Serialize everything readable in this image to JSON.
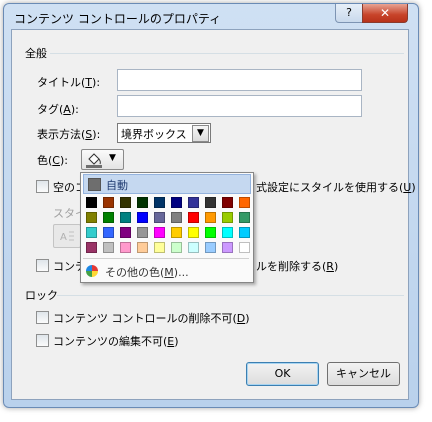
{
  "window": {
    "title": "コンテンツ コントロールのプロパティ",
    "help_label": "?",
    "close_label": "✕"
  },
  "general": {
    "section_label": "全般",
    "title_label": "タイトル(",
    "title_key": "T",
    "tag_label": "タグ(",
    "tag_key": "A",
    "show_as_label": "表示方法(",
    "show_as_key": "S",
    "show_as_value": "境界ボックス",
    "color_label": "色(",
    "color_key": "C",
    "style_check_label_pre": "空のコ",
    "style_check_label_post": "式設定にスタイルを使用する(",
    "style_check_key": "U",
    "style_label": "スタイ",
    "remove_check_label_pre": "コンテ",
    "remove_check_label_post": "ルを削除する(",
    "remove_check_key": "R",
    "close_paren": ")"
  },
  "lock": {
    "section_label": "ロック",
    "no_delete_label": "コンテンツ コントロールの削除不可(",
    "no_delete_key": "D",
    "no_edit_label": "コンテンツの編集不可(",
    "no_edit_key": "E"
  },
  "buttons": {
    "ok": "OK",
    "cancel": "キャンセル"
  },
  "color_popup": {
    "automatic_label": "自動",
    "more_colors_label": "その他の色(",
    "more_colors_key": "M",
    "more_colors_suffix": ")...",
    "colors": [
      [
        "#000000",
        "#993300",
        "#333300",
        "#003300",
        "#003366",
        "#000080",
        "#333399",
        "#333333",
        "#800000",
        "#ff6600"
      ],
      [
        "#808000",
        "#008000",
        "#008080",
        "#0000ff",
        "#666699",
        "#808080",
        "#ff0000",
        "#ff9900",
        "#99cc00",
        "#339966"
      ],
      [
        "#33cccc",
        "#3366ff",
        "#800080",
        "#969696",
        "#ff00ff",
        "#ffcc00",
        "#ffff00",
        "#00ff00",
        "#00ffff",
        "#00ccff"
      ],
      [
        "#993366",
        "#c0c0c0",
        "#ff99cc",
        "#ffcc99",
        "#ffff99",
        "#ccffcc",
        "#ccffff",
        "#99ccff",
        "#cc99ff",
        "#ffffff"
      ]
    ]
  },
  "icons": {
    "paint_bucket": "paint-bucket-icon",
    "dropdown": "▼"
  }
}
